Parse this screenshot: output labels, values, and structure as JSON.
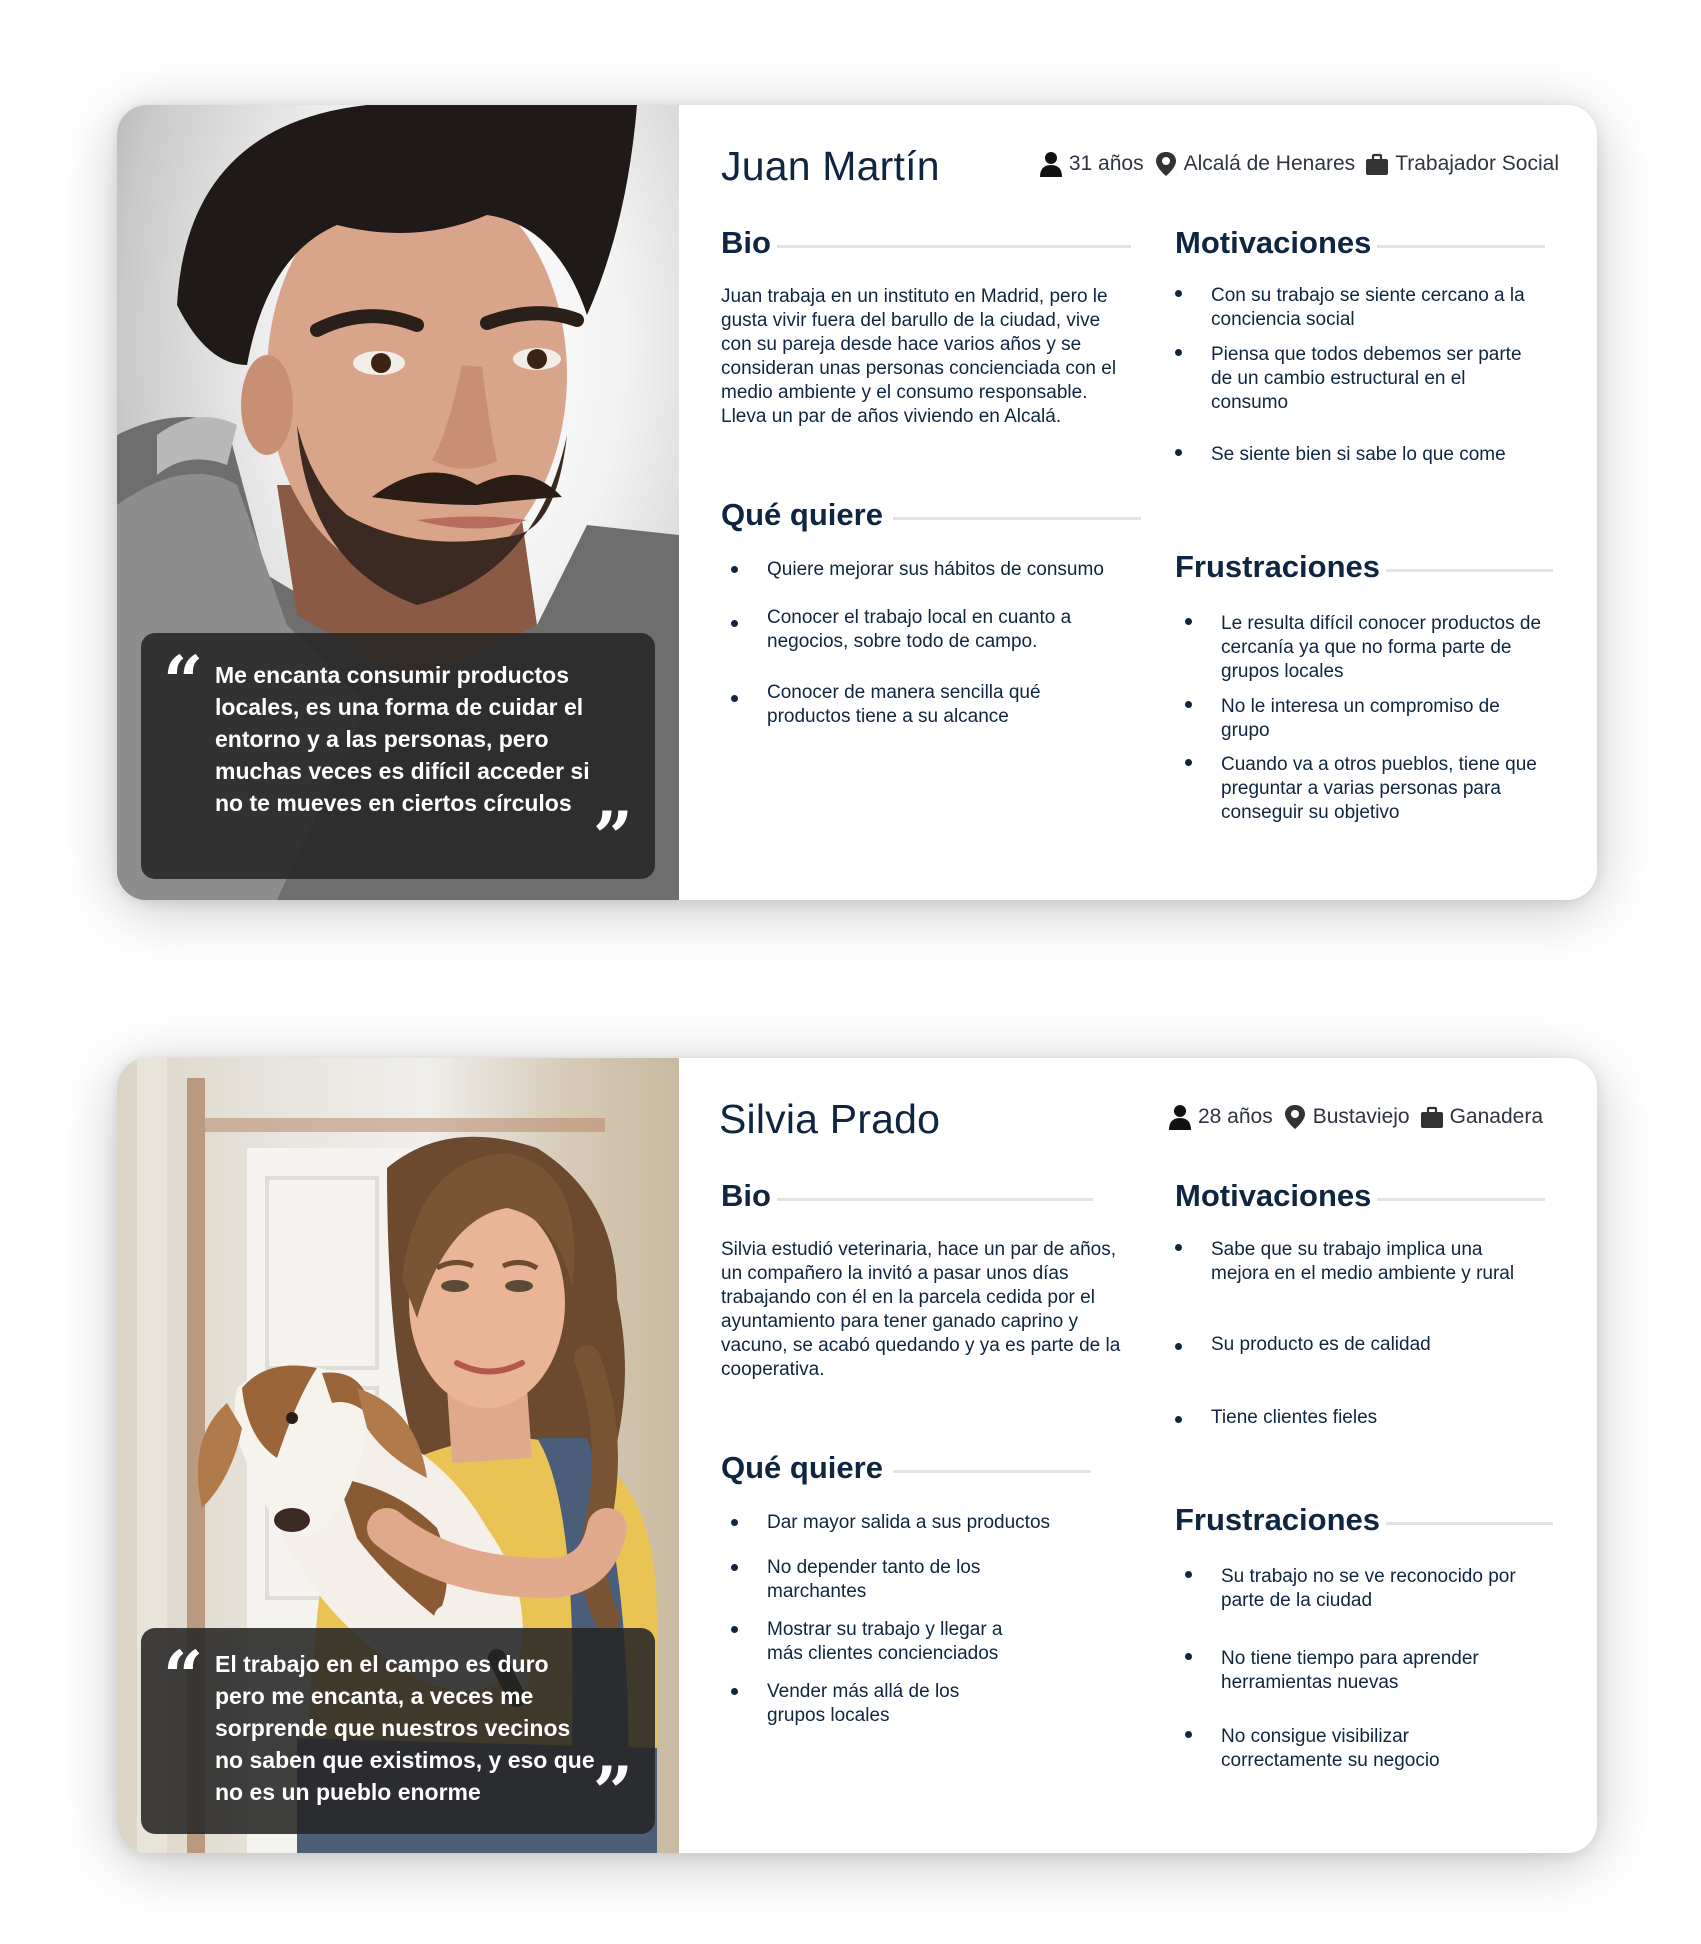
{
  "personas": [
    {
      "name": "Juan Martín",
      "age": "31 años",
      "location": "Alcalá de Henares",
      "job": "Trabajador Social",
      "quote": "Me encanta consumir productos locales, es una forma de cuidar el entorno y a las personas, pero muchas veces es difícil acceder si no te mueves en ciertos círculos",
      "bio_title": "Bio",
      "bio": "Juan trabaja en un instituto en Madrid, pero le gusta vivir fuera del barullo de la ciudad, vive con su pareja desde hace varios años y se consideran unas personas concienciada con el medio ambiente y el consumo responsable. Lleva un par de años viviendo en Alcalá.",
      "wants_title": "Qué quiere",
      "wants": [
        "Quiere mejorar sus hábitos de consumo",
        "Conocer el trabajo local en cuanto a negocios, sobre todo de campo.",
        "Conocer de manera sencilla qué productos tiene a su alcance"
      ],
      "motivations_title": "Motivaciones",
      "motivations": [
        "Con su trabajo se siente cercano a la conciencia social",
        "Piensa que todos debemos ser parte de un cambio estructural en el consumo",
        "Se siente bien si sabe lo que come"
      ],
      "frustrations_title": "Frustraciones",
      "frustrations": [
        "Le resulta difícil conocer productos de cercanía ya que no forma parte de grupos locales",
        "No le interesa un compromiso de grupo",
        "Cuando va a otros pueblos, tiene que preguntar a varias personas para conseguir su objetivo"
      ]
    },
    {
      "name": "Silvia Prado",
      "age": "28 años",
      "location": "Bustaviejo",
      "job": "Ganadera",
      "quote": "El trabajo en el campo es duro pero me encanta, a veces me sorprende que nuestros vecinos no saben que existimos, y eso que no es un pueblo enorme",
      "bio_title": "Bio",
      "bio": "Silvia estudió veterinaria, hace un par de años, un compañero la invitó a pasar unos días trabajando con él en la parcela cedida por el ayuntamiento para tener ganado caprino y vacuno, se acabó quedando y ya es parte de la cooperativa.",
      "wants_title": "Qué quiere",
      "wants": [
        "Dar mayor salida a sus productos",
        "No depender tanto de los marchantes",
        "Mostrar su trabajo y llegar a más clientes concienciados",
        "Vender más allá de los grupos locales"
      ],
      "motivations_title": "Motivaciones",
      "motivations": [
        "Sabe que su trabajo implica una mejora en el medio ambiente y rural",
        "Su producto es de calidad",
        "Tiene clientes fieles"
      ],
      "frustrations_title": "Frustraciones",
      "frustrations": [
        "Su trabajo no se ve reconocido por parte de la ciudad",
        "No tiene tiempo para aprender herramientas nuevas",
        "No consigue visibilizar correctamente su negocio"
      ]
    }
  ],
  "icons": {
    "age": "person-icon",
    "location": "location-pin-icon",
    "job": "briefcase-icon",
    "quote_open": "quote-open-icon",
    "quote_close": "quote-close-icon"
  },
  "colors": {
    "text": "#0f2540",
    "quote_bg": "#262626",
    "rule": "#e3e3e3"
  }
}
